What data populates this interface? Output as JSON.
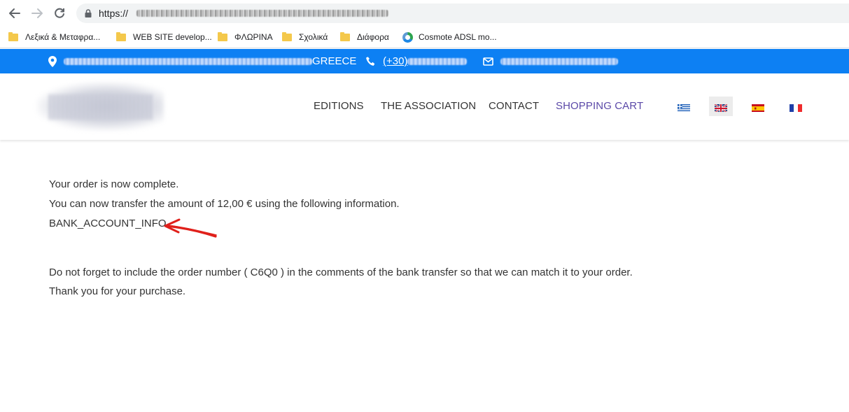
{
  "browser": {
    "url_scheme": "https://",
    "bookmarks": [
      {
        "label": "Λεξικά & Μεταφρα...",
        "icon": "folder-icon"
      },
      {
        "label": "WEB SITE develop...",
        "icon": "folder-icon"
      },
      {
        "label": "ΦΛΩΡΙΝΑ",
        "icon": "folder-icon"
      },
      {
        "label": "Σχολικά",
        "icon": "folder-icon"
      },
      {
        "label": "Διάφορα",
        "icon": "folder-icon"
      },
      {
        "label": "Cosmote ADSL mo...",
        "icon": "cosmote-icon"
      }
    ]
  },
  "topbar": {
    "address_suffix": "GREECE",
    "phone_prefix": "(+30)",
    "color": "#0d80f3"
  },
  "nav": {
    "items": [
      {
        "label": "EDITIONS"
      },
      {
        "label": "THE ASSOCIATION"
      },
      {
        "label": "CONTACT"
      },
      {
        "label": "SHOPPING CART",
        "active": true
      }
    ],
    "active_color": "#5b49a8",
    "languages": [
      "greek-flag-icon",
      "uk-flag-icon",
      "spain-flag-icon",
      "france-flag-icon"
    ]
  },
  "content": {
    "line1": "Your order is now complete.",
    "line2": "You can now transfer the amount of 12,00 € using the following information.",
    "line3": "BANK_ACCOUNT_INFO",
    "line4": "Do not forget to include the order number ( C6Q0 ) in the comments of the bank transfer so that we can match it to your order.",
    "line5": "Thank you for your purchase.",
    "annotation_color": "#e0201b"
  }
}
